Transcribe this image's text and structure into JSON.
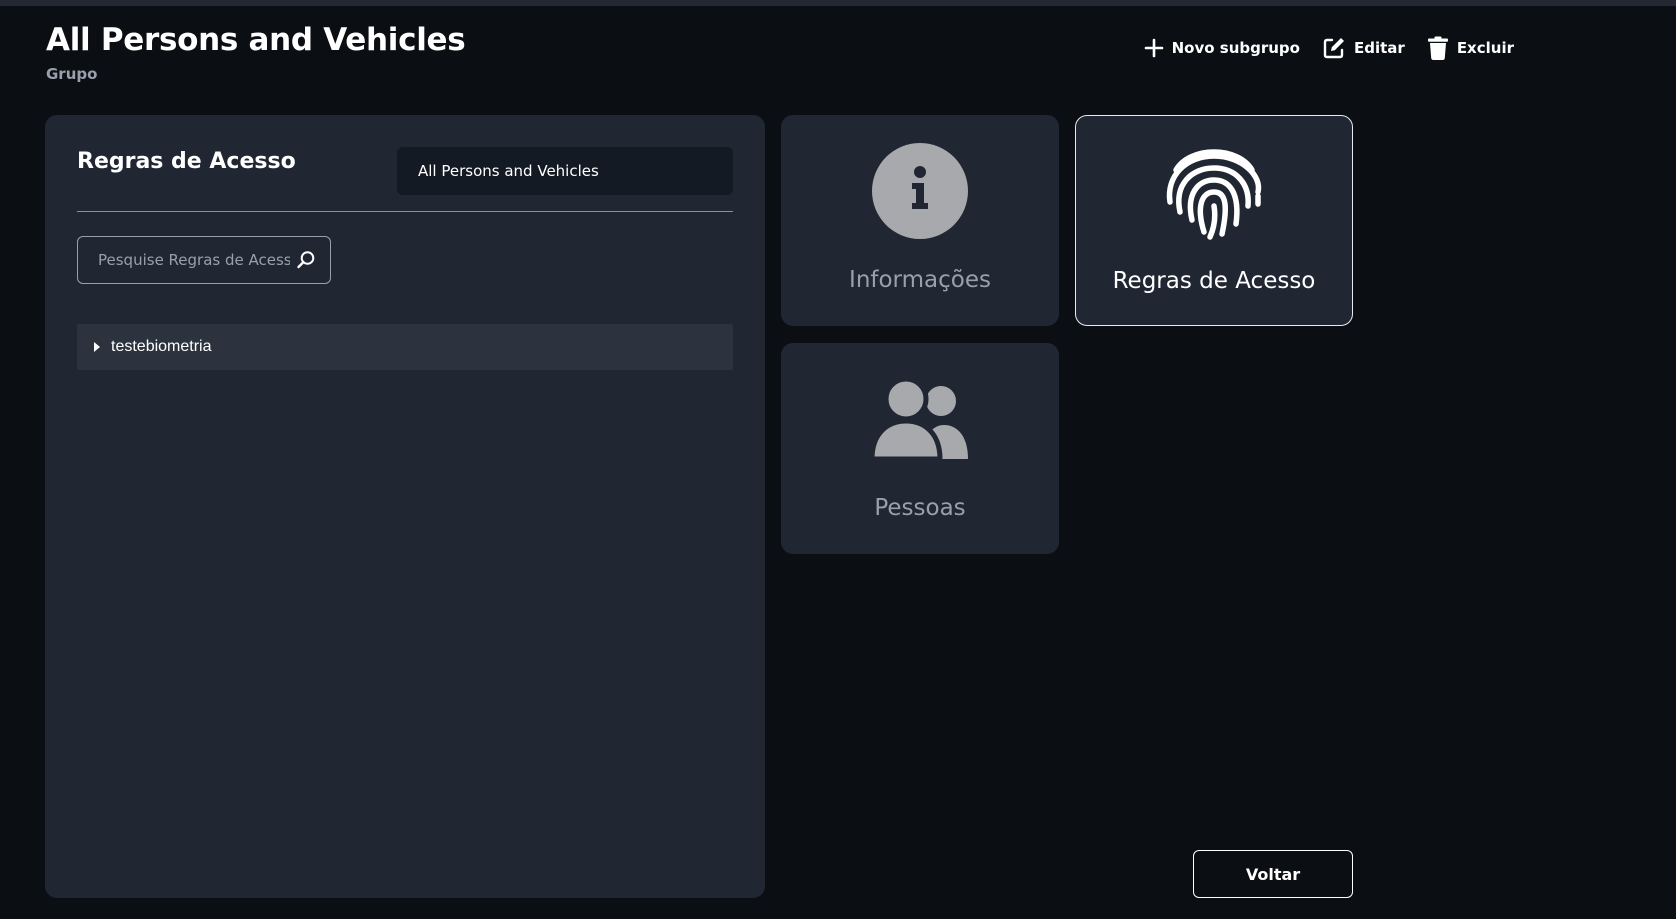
{
  "header": {
    "title": "All Persons and Vehicles",
    "subtitle": "Grupo",
    "actions": {
      "new_subgroup": {
        "label": "Novo subgrupo",
        "icon": "plus-icon"
      },
      "edit": {
        "label": "Editar",
        "icon": "edit-icon"
      },
      "delete": {
        "label": "Excluir",
        "icon": "trash-icon"
      }
    }
  },
  "access_rules_panel": {
    "title": "Regras de Acesso",
    "group_name": "All Persons and Vehicles",
    "search": {
      "placeholder": "Pesquise Regras de Acesso",
      "value": ""
    },
    "items": [
      {
        "label": "testebiometria",
        "expanded": false
      }
    ]
  },
  "tiles": [
    {
      "label": "Informações",
      "icon": "info-icon",
      "active": false
    },
    {
      "label": "Regras de Acesso",
      "icon": "fingerprint-icon",
      "active": true
    },
    {
      "label": "Pessoas",
      "icon": "people-icon",
      "active": false
    }
  ],
  "footer": {
    "back_label": "Voltar"
  },
  "colors": {
    "background": "#0b0e13",
    "panel": "#202733",
    "muted_text": "#9aa0aa",
    "icon_gray": "#a7a9ad",
    "active_border": "#e8eaee"
  }
}
